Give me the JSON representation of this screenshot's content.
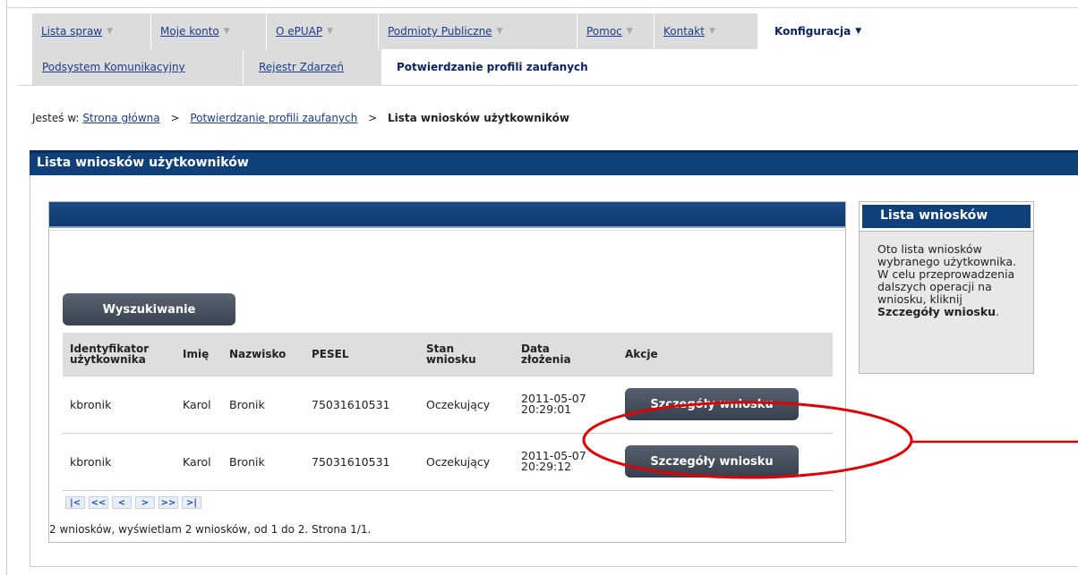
{
  "nav_primary": [
    {
      "label": "Lista spraw"
    },
    {
      "label": "Moje konto"
    },
    {
      "label": "O ePUAP"
    },
    {
      "label": "Podmioty Publiczne"
    },
    {
      "label": "Pomoc"
    },
    {
      "label": "Kontakt"
    },
    {
      "label": "Konfiguracja",
      "active": true
    }
  ],
  "nav_secondary": [
    {
      "label": "Podsystem Komunikacyjny"
    },
    {
      "label": "Rejestr Zdarzeń"
    },
    {
      "label": "Potwierdzanie profili zaufanych",
      "active": true
    }
  ],
  "breadcrumb": {
    "prefix": "Jesteś w:",
    "home": "Strona główna",
    "section": "Potwierdzanie profili zaufanych",
    "current": "Lista wniosków użytkowników",
    "separator": ">"
  },
  "page_title": "Lista wniosków użytkowników",
  "search_button": "Wyszukiwanie",
  "table": {
    "columns": [
      "Identyfikator użytkownika",
      "Imię",
      "Nazwisko",
      "PESEL",
      "Stan wniosku",
      "Data złożenia",
      "Akcje"
    ],
    "rows": [
      {
        "user_id": "kbronik",
        "first_name": "Karol",
        "last_name": "Bronik",
        "pesel": "75031610531",
        "status": "Oczekujący",
        "date": "2011-05-07",
        "time": "20:29:01",
        "action": "Szczegóły wniosku"
      },
      {
        "user_id": "kbronik",
        "first_name": "Karol",
        "last_name": "Bronik",
        "pesel": "75031610531",
        "status": "Oczekujący",
        "date": "2011-05-07",
        "time": "20:29:12",
        "action": "Szczegóły wniosku"
      }
    ]
  },
  "pager": {
    "buttons": [
      "first",
      "prev-page",
      "prev",
      "next",
      "next-page",
      "last"
    ],
    "glyphs": [
      "|<",
      "<<",
      "<",
      ">",
      ">>",
      ">|"
    ],
    "summary": "2 wniosków, wyświetlam 2 wniosków, od 1 do 2. Strona 1/1."
  },
  "sidebar": {
    "title": "Lista wniosków",
    "text": "Oto lista wniosków wybranego użytkownika. W celu przeprowadzenia dalszych operacji na wniosku, kliknij",
    "emphasis": "Szczegóły wniosku",
    "suffix": "."
  },
  "colors": {
    "header_blue": "#10407a",
    "nav_grey": "#dcdcdc",
    "link_blue": "#1a3c8c",
    "button_dark": "#3a4451",
    "annotation_red": "#e00000"
  }
}
